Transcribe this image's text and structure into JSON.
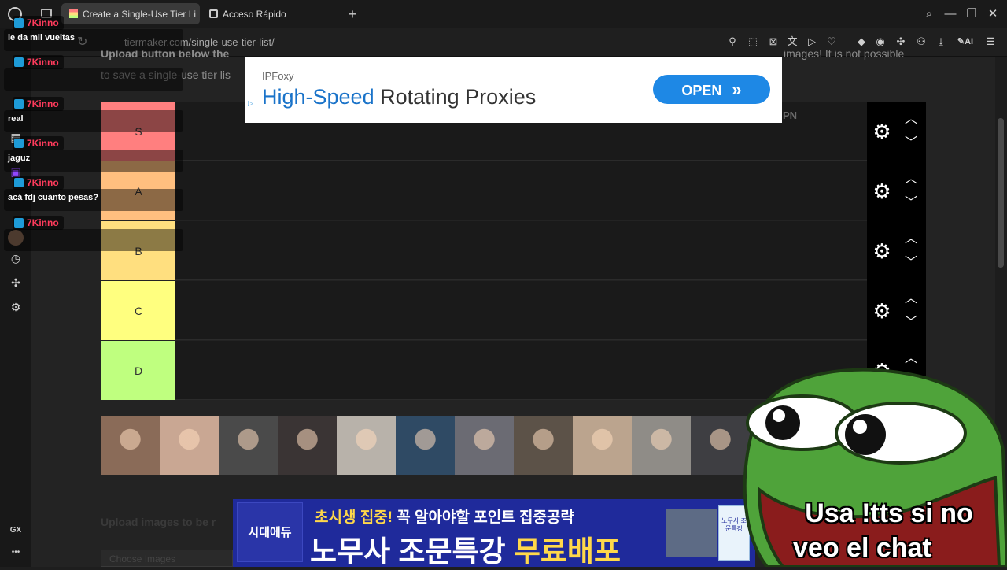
{
  "browser": {
    "tabs": [
      {
        "label": "Create a Single-Use Tier Li",
        "active": true
      },
      {
        "label": "Acceso Rápido",
        "active": false
      }
    ],
    "url": "tiermaker.com/single-use-tier-list/",
    "ai_label": "AI"
  },
  "page": {
    "intro_line1": "Upload button below the",
    "intro_line1_right": "images! It is not possible",
    "intro_line2": "to save a single-use tier lis",
    "upload_caption": "Upload images to be r",
    "choose_button": "Choose Images"
  },
  "tiers": [
    {
      "label": "S",
      "color": "#ff7f7f"
    },
    {
      "label": "A",
      "color": "#ffbf7f"
    },
    {
      "label": "B",
      "color": "#ffdf7f"
    },
    {
      "label": "C",
      "color": "#ffff7f"
    },
    {
      "label": "D",
      "color": "#bfff7f"
    }
  ],
  "thumbnails": [
    {
      "color": "#8a6b58"
    },
    {
      "color": "#c9a793"
    },
    {
      "color": "#4a4a4a"
    },
    {
      "color": "#3a3434"
    },
    {
      "color": "#b8b2aa"
    },
    {
      "color": "#2f4a64"
    },
    {
      "color": "#6b6b73"
    },
    {
      "color": "#5c5248"
    },
    {
      "color": "#bba48e"
    },
    {
      "color": "#8f8c87"
    },
    {
      "color": "#3e3e42"
    }
  ],
  "ad_top": {
    "brand": "IPFoxy",
    "headline_highlight": "High-Speed",
    "headline_rest": "Rotating Proxies",
    "button": "OPEN",
    "button_icon": "»",
    "cut_text": "PN"
  },
  "ad_bottom": {
    "logo": "시대에듀",
    "line1_highlight": "초시생 집중!",
    "line1_rest": "꼭 알아야할 포인트 집중공략",
    "line2_main": "노무사 조문특강",
    "line2_highlight": "무료배포",
    "book_label": "노무사 조문특강"
  },
  "chat": [
    {
      "user": "7Kinno",
      "message": "le da mil vueltas"
    },
    {
      "user": "7Kinno",
      "message": ""
    },
    {
      "user": "7Kinno",
      "message": "real"
    },
    {
      "user": "7Kinno",
      "message": "jaguz"
    },
    {
      "user": "7Kinno",
      "message": "acá fdj cuánto pesas?"
    },
    {
      "user": "7Kinno",
      "message": ""
    }
  ],
  "overlay": {
    "line1": "Usa !tts si no",
    "line2": "veo el chat"
  },
  "sidebar": {
    "gx_label": "GX",
    "more_label": "•••"
  }
}
